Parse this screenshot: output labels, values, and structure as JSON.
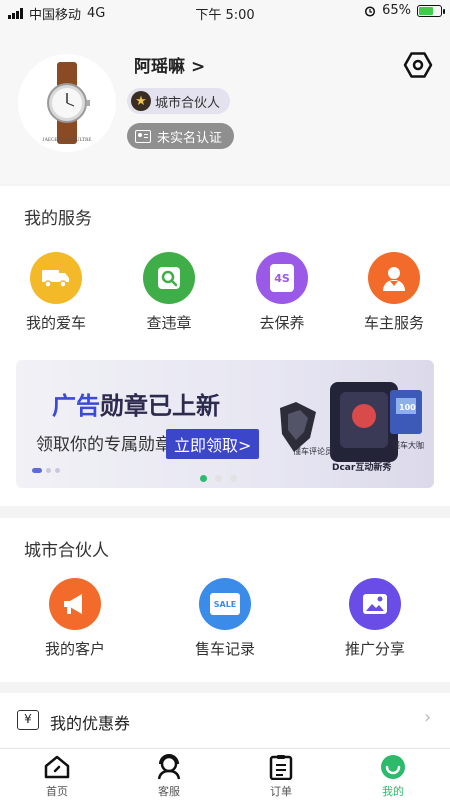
{
  "status_bar": {
    "carrier": "中国移动",
    "network": "4G",
    "time": "下午 5:00",
    "battery": "65%"
  },
  "profile": {
    "username": "阿瑶嘛",
    "username_chevron": ">",
    "partner_badge": "城市合伙人",
    "verify_badge": "未实名认证",
    "avatar_brand": "JAEGER-LECOULTRE"
  },
  "services": {
    "title": "我的服务",
    "items": [
      {
        "label": "我的爱车",
        "color": "#f3b929",
        "icon": "truck-icon"
      },
      {
        "label": "查违章",
        "color": "#3fae49",
        "icon": "search-icon"
      },
      {
        "label": "去保养",
        "color": "#9b59e8",
        "icon": "oil-icon",
        "icon_text": "4S"
      },
      {
        "label": "车主服务",
        "color": "#f26b2b",
        "icon": "person-icon"
      }
    ]
  },
  "banner": {
    "headline_ad": "广告",
    "headline_rest": "勋章已上新",
    "subtitle": "领取你的专属勋章",
    "cta": "立即领取>",
    "badge_texts": [
      "Dcar互动新秀",
      "懂车评论员",
      "懂车大咖",
      "100"
    ]
  },
  "partner": {
    "title": "城市合伙人",
    "items": [
      {
        "label": "我的客户",
        "color": "#f26b2b",
        "icon": "megaphone-icon"
      },
      {
        "label": "售车记录",
        "color": "#3b8be8",
        "icon": "sale-tag-icon",
        "icon_text": "SALE"
      },
      {
        "label": "推广分享",
        "color": "#6a4de6",
        "icon": "image-icon"
      }
    ]
  },
  "coupon": {
    "label": "我的优惠券",
    "icon_text": "¥",
    "arrow": "›"
  },
  "tabs": [
    {
      "label": "首页",
      "icon": "home-icon"
    },
    {
      "label": "客服",
      "icon": "support-icon"
    },
    {
      "label": "订单",
      "icon": "order-icon"
    },
    {
      "label": "我的",
      "icon": "profile-icon",
      "active": true
    }
  ],
  "colors": {
    "accent": "#2cba6b",
    "banner_button": "#3c46c9",
    "page_bg": "#f4f4f4"
  }
}
